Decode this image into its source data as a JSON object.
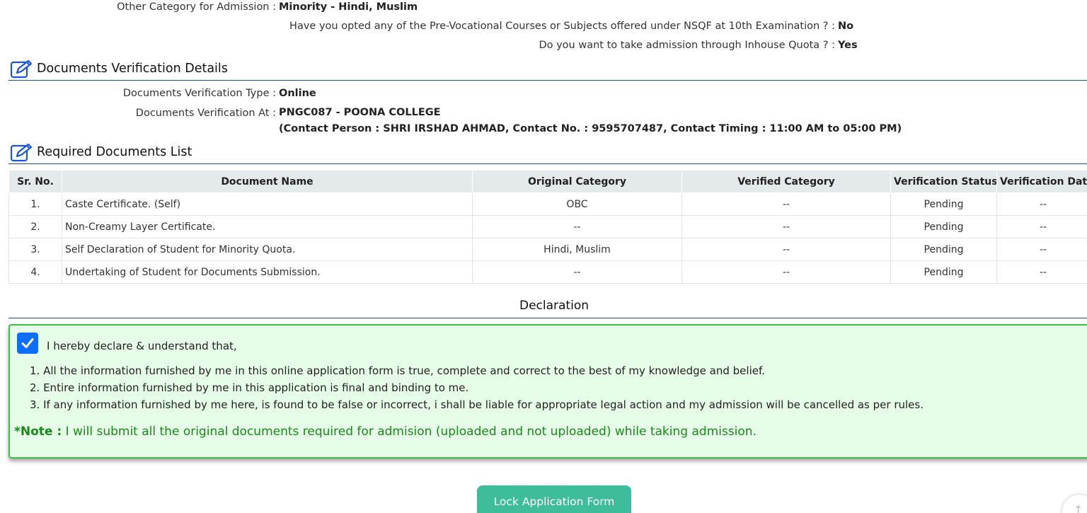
{
  "admission": {
    "other_category_label": "Other Category for Admission :",
    "other_category_value": "Minority - Hindi, Muslim",
    "nsqf_label": "Have you opted any of the Pre-Vocational Courses or Subjects offered under NSQF at 10th Examination ? :",
    "nsqf_value": "No",
    "inhouse_label": "Do you want to take admission through Inhouse Quota ? :",
    "inhouse_value": "Yes"
  },
  "doc_verification": {
    "heading": "Documents Verification Details",
    "heading_icon": "edit-icon",
    "type_label": "Documents Verification Type :",
    "type_value": "Online",
    "at_label": "Documents Verification At :",
    "at_value": "PNGC087 - POONA COLLEGE",
    "contact_value": "(Contact Person : SHRI IRSHAD AHMAD, Contact No. : 9595707487, Contact Timing : 11:00 AM to 05:00 PM)"
  },
  "required_docs": {
    "heading": "Required Documents List",
    "heading_icon": "edit-icon",
    "columns": [
      "Sr. No.",
      "Document Name",
      "Original Category",
      "Verified Category",
      "Verification Status",
      "Verification Date"
    ],
    "rows": [
      {
        "sr": "1.",
        "name": "Caste Certificate. (Self)",
        "original": "OBC",
        "verified": "--",
        "status": "Pending",
        "date": "--"
      },
      {
        "sr": "2.",
        "name": "Non-Creamy Layer Certificate.",
        "original": "--",
        "verified": "--",
        "status": "Pending",
        "date": "--"
      },
      {
        "sr": "3.",
        "name": "Self Declaration of Student for Minority Quota.",
        "original": "Hindi, Muslim",
        "verified": "--",
        "status": "Pending",
        "date": "--"
      },
      {
        "sr": "4.",
        "name": "Undertaking of Student for Documents Submission.",
        "original": "--",
        "verified": "--",
        "status": "Pending",
        "date": "--"
      }
    ]
  },
  "declaration": {
    "title": "Declaration",
    "intro": "I hereby declare & understand that,",
    "items": [
      "1. All the information furnished by me in this online application form is true, complete and correct to the best of my knowledge and belief.",
      "2. Entire information furnished by me in this application is final and binding to me.",
      "3. If any information furnished by me here, is found to be false or incorrect, i shall be liable for appropriate legal action and my admission will be cancelled as per rules."
    ],
    "note_label": "*Note :",
    "note_text": " I will submit all the original documents required for admision (uploaded and not uploaded) while taking admission.",
    "checked": true
  },
  "actions": {
    "lock_label": "Lock Application Form",
    "scroll_icon": "arrow-up-icon"
  },
  "colors": {
    "accent": "#0d6efd",
    "success_bg": "#e6fde7",
    "success_border": "#3dbd4a",
    "note_text": "#1a8a1a",
    "button_bg": "#3dbd9a",
    "rule": "#1e4f6e"
  }
}
